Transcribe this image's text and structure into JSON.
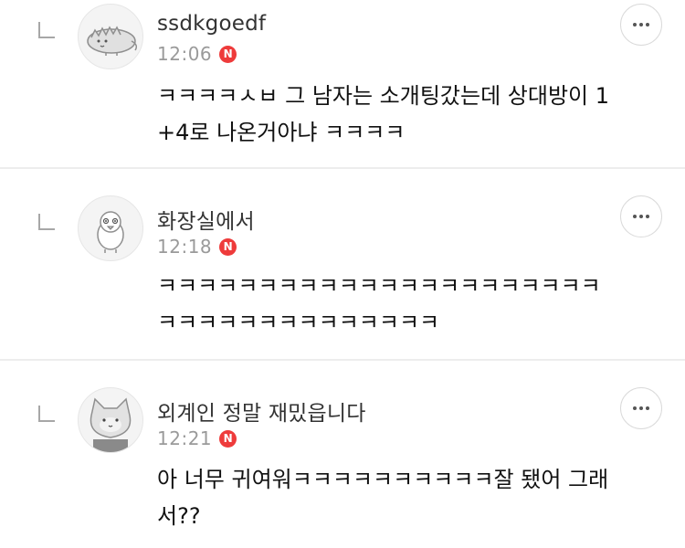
{
  "comments": [
    {
      "nickname": "ssdkgoedf",
      "time": "12:06",
      "badge": "N",
      "text": "ㅋㅋㅋㅋㅅㅂ 그 남자는 소개팅갔는데 상대방이 1\n+4로 나온거아냐 ㅋㅋㅋㅋ",
      "avatar_icon": "dinosaur-avatar-icon"
    },
    {
      "nickname": "화장실에서",
      "time": "12:18",
      "badge": "N",
      "text": "ㅋㅋㅋㅋㅋㅋㅋㅋㅋㅋㅋㅋㅋㅋㅋㅋㅋㅋㅋㅋㅋㅋ\nㅋㅋㅋㅋㅋㅋㅋㅋㅋㅋㅋㅋㅋㅋ",
      "avatar_icon": "bird-avatar-icon"
    },
    {
      "nickname": "외계인 정말 재밌읍니다",
      "time": "12:21",
      "badge": "N",
      "text": "아 너무 귀여워ㅋㅋㅋㅋㅋㅋㅋㅋㅋㅋ잘 됐어 그래\n서??",
      "avatar_icon": "cat-avatar-icon"
    }
  ],
  "colors": {
    "badge": "#ee3b3b",
    "divider": "#ededed",
    "time": "#9a9a9a"
  }
}
